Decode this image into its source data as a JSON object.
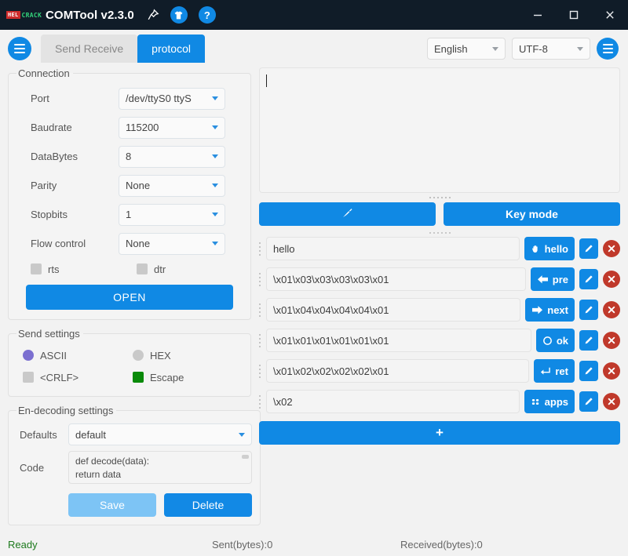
{
  "titlebar": {
    "logo_a": "HEL",
    "logo_b": "CRACK",
    "title": "COMTool v2.3.0",
    "pin_icon": "pin-icon",
    "theme_icon": "tshirt-icon",
    "help_icon": "help-icon",
    "help_label": "?",
    "minimize_label": "minimize-icon",
    "maximize_label": "maximize-icon",
    "close_label": "close-icon"
  },
  "toolbar": {
    "menu_icon": "hamburger-icon",
    "tabs": [
      {
        "label": "Send Receive",
        "active": false
      },
      {
        "label": "protocol",
        "active": true
      }
    ],
    "language": {
      "value": "English"
    },
    "encoding": {
      "value": "UTF-8"
    },
    "right_menu_icon": "hamburger-icon"
  },
  "connection": {
    "legend": "Connection",
    "fields": [
      {
        "label": "Port",
        "value": "/dev/ttyS0 ttyS"
      },
      {
        "label": "Baudrate",
        "value": "115200"
      },
      {
        "label": "DataBytes",
        "value": "8"
      },
      {
        "label": "Parity",
        "value": "None"
      },
      {
        "label": "Stopbits",
        "value": "1"
      },
      {
        "label": "Flow control",
        "value": "None"
      }
    ],
    "rts_label": "rts",
    "dtr_label": "dtr",
    "open_label": "OPEN"
  },
  "send_settings": {
    "legend": "Send settings",
    "ascii_label": "ASCII",
    "hex_label": "HEX",
    "crlf_label": "<CRLF>",
    "escape_label": "Escape"
  },
  "endecoding": {
    "legend": "En-decoding settings",
    "defaults_label": "Defaults",
    "defaults_value": "default",
    "code_label": "Code",
    "code_line1": "def decode(data):",
    "code_line2": "   return data",
    "save_label": "Save",
    "delete_label": "Delete"
  },
  "receive": {
    "value": "",
    "placeholder": ""
  },
  "send_actions": {
    "clear_icon": "broom-icon",
    "clear_label": "",
    "key_mode_label": "Key mode"
  },
  "protocol_rows": [
    {
      "value": "hello",
      "key_label": "hello",
      "key_icon": "hand-icon",
      "key_glyph": "✋",
      "edit_icon": "pencil-icon",
      "delete_icon": "close-circle-icon"
    },
    {
      "value": "\\x01\\x03\\x03\\x03\\x03\\x01",
      "key_label": "pre",
      "key_icon": "arrow-left-icon",
      "key_glyph": "⬅",
      "edit_icon": "pencil-icon",
      "delete_icon": "close-circle-icon"
    },
    {
      "value": "\\x01\\x04\\x04\\x04\\x04\\x01",
      "key_label": "next",
      "key_icon": "arrow-right-icon",
      "key_glyph": "➡",
      "edit_icon": "pencil-icon",
      "delete_icon": "close-circle-icon"
    },
    {
      "value": "\\x01\\x01\\x01\\x01\\x01\\x01",
      "key_label": "ok",
      "key_icon": "circle-icon",
      "key_glyph": "◯",
      "edit_icon": "pencil-icon",
      "delete_icon": "close-circle-icon"
    },
    {
      "value": "\\x01\\x02\\x02\\x02\\x02\\x01",
      "key_label": "ret",
      "key_icon": "enter-icon",
      "key_glyph": "↵",
      "edit_icon": "pencil-icon",
      "delete_icon": "close-circle-icon"
    },
    {
      "value": "\\x02",
      "key_label": "apps",
      "key_icon": "grid-icon",
      "key_glyph": "∷",
      "edit_icon": "pencil-icon",
      "delete_icon": "close-circle-icon"
    }
  ],
  "add_button": {
    "label": "+",
    "icon": "plus-icon"
  },
  "status": {
    "ready": "Ready",
    "sent": "Sent(bytes):0",
    "received": "Received(bytes):0"
  },
  "colors": {
    "accent": "#1089e4",
    "titlebar": "#101c28",
    "danger": "#c0392b",
    "ready": "#1d7a1d",
    "escape": "#0a8a0a",
    "ascii_radio": "#7b6fd0",
    "save": "#7dc4f5"
  }
}
